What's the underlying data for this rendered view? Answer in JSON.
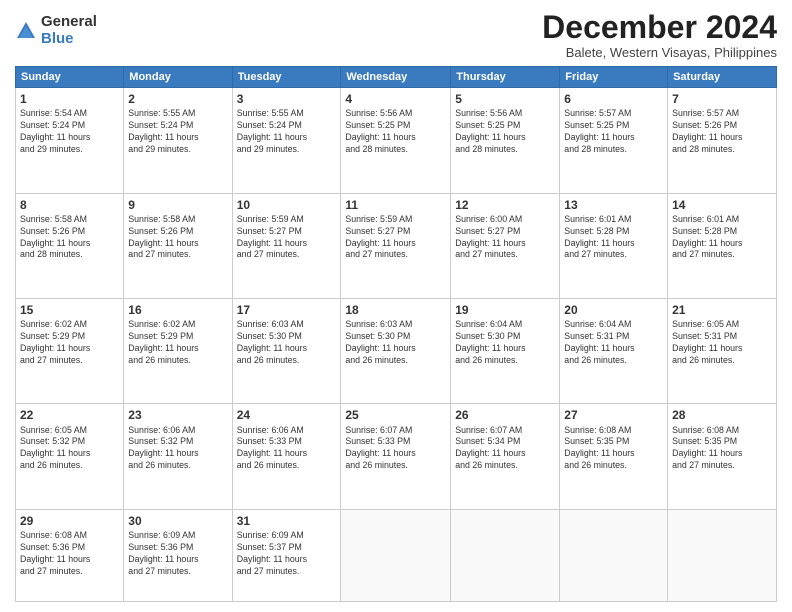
{
  "logo": {
    "general": "General",
    "blue": "Blue"
  },
  "title": "December 2024",
  "location": "Balete, Western Visayas, Philippines",
  "days_of_week": [
    "Sunday",
    "Monday",
    "Tuesday",
    "Wednesday",
    "Thursday",
    "Friday",
    "Saturday"
  ],
  "weeks": [
    [
      {
        "day": "1",
        "info": "Sunrise: 5:54 AM\nSunset: 5:24 PM\nDaylight: 11 hours\nand 29 minutes."
      },
      {
        "day": "2",
        "info": "Sunrise: 5:55 AM\nSunset: 5:24 PM\nDaylight: 11 hours\nand 29 minutes."
      },
      {
        "day": "3",
        "info": "Sunrise: 5:55 AM\nSunset: 5:24 PM\nDaylight: 11 hours\nand 29 minutes."
      },
      {
        "day": "4",
        "info": "Sunrise: 5:56 AM\nSunset: 5:25 PM\nDaylight: 11 hours\nand 28 minutes."
      },
      {
        "day": "5",
        "info": "Sunrise: 5:56 AM\nSunset: 5:25 PM\nDaylight: 11 hours\nand 28 minutes."
      },
      {
        "day": "6",
        "info": "Sunrise: 5:57 AM\nSunset: 5:25 PM\nDaylight: 11 hours\nand 28 minutes."
      },
      {
        "day": "7",
        "info": "Sunrise: 5:57 AM\nSunset: 5:26 PM\nDaylight: 11 hours\nand 28 minutes."
      }
    ],
    [
      {
        "day": "8",
        "info": "Sunrise: 5:58 AM\nSunset: 5:26 PM\nDaylight: 11 hours\nand 28 minutes."
      },
      {
        "day": "9",
        "info": "Sunrise: 5:58 AM\nSunset: 5:26 PM\nDaylight: 11 hours\nand 27 minutes."
      },
      {
        "day": "10",
        "info": "Sunrise: 5:59 AM\nSunset: 5:27 PM\nDaylight: 11 hours\nand 27 minutes."
      },
      {
        "day": "11",
        "info": "Sunrise: 5:59 AM\nSunset: 5:27 PM\nDaylight: 11 hours\nand 27 minutes."
      },
      {
        "day": "12",
        "info": "Sunrise: 6:00 AM\nSunset: 5:27 PM\nDaylight: 11 hours\nand 27 minutes."
      },
      {
        "day": "13",
        "info": "Sunrise: 6:01 AM\nSunset: 5:28 PM\nDaylight: 11 hours\nand 27 minutes."
      },
      {
        "day": "14",
        "info": "Sunrise: 6:01 AM\nSunset: 5:28 PM\nDaylight: 11 hours\nand 27 minutes."
      }
    ],
    [
      {
        "day": "15",
        "info": "Sunrise: 6:02 AM\nSunset: 5:29 PM\nDaylight: 11 hours\nand 27 minutes."
      },
      {
        "day": "16",
        "info": "Sunrise: 6:02 AM\nSunset: 5:29 PM\nDaylight: 11 hours\nand 26 minutes."
      },
      {
        "day": "17",
        "info": "Sunrise: 6:03 AM\nSunset: 5:30 PM\nDaylight: 11 hours\nand 26 minutes."
      },
      {
        "day": "18",
        "info": "Sunrise: 6:03 AM\nSunset: 5:30 PM\nDaylight: 11 hours\nand 26 minutes."
      },
      {
        "day": "19",
        "info": "Sunrise: 6:04 AM\nSunset: 5:30 PM\nDaylight: 11 hours\nand 26 minutes."
      },
      {
        "day": "20",
        "info": "Sunrise: 6:04 AM\nSunset: 5:31 PM\nDaylight: 11 hours\nand 26 minutes."
      },
      {
        "day": "21",
        "info": "Sunrise: 6:05 AM\nSunset: 5:31 PM\nDaylight: 11 hours\nand 26 minutes."
      }
    ],
    [
      {
        "day": "22",
        "info": "Sunrise: 6:05 AM\nSunset: 5:32 PM\nDaylight: 11 hours\nand 26 minutes."
      },
      {
        "day": "23",
        "info": "Sunrise: 6:06 AM\nSunset: 5:32 PM\nDaylight: 11 hours\nand 26 minutes."
      },
      {
        "day": "24",
        "info": "Sunrise: 6:06 AM\nSunset: 5:33 PM\nDaylight: 11 hours\nand 26 minutes."
      },
      {
        "day": "25",
        "info": "Sunrise: 6:07 AM\nSunset: 5:33 PM\nDaylight: 11 hours\nand 26 minutes."
      },
      {
        "day": "26",
        "info": "Sunrise: 6:07 AM\nSunset: 5:34 PM\nDaylight: 11 hours\nand 26 minutes."
      },
      {
        "day": "27",
        "info": "Sunrise: 6:08 AM\nSunset: 5:35 PM\nDaylight: 11 hours\nand 26 minutes."
      },
      {
        "day": "28",
        "info": "Sunrise: 6:08 AM\nSunset: 5:35 PM\nDaylight: 11 hours\nand 27 minutes."
      }
    ],
    [
      {
        "day": "29",
        "info": "Sunrise: 6:08 AM\nSunset: 5:36 PM\nDaylight: 11 hours\nand 27 minutes."
      },
      {
        "day": "30",
        "info": "Sunrise: 6:09 AM\nSunset: 5:36 PM\nDaylight: 11 hours\nand 27 minutes."
      },
      {
        "day": "31",
        "info": "Sunrise: 6:09 AM\nSunset: 5:37 PM\nDaylight: 11 hours\nand 27 minutes."
      },
      {
        "day": "",
        "info": ""
      },
      {
        "day": "",
        "info": ""
      },
      {
        "day": "",
        "info": ""
      },
      {
        "day": "",
        "info": ""
      }
    ]
  ]
}
